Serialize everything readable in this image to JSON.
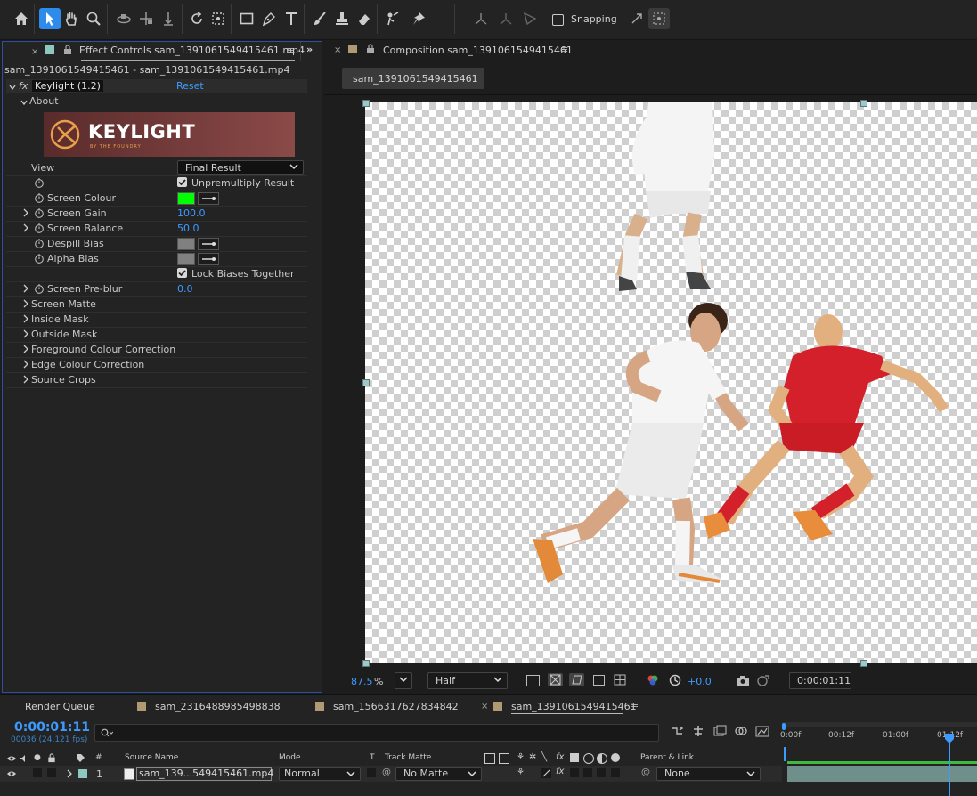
{
  "toolbar": {
    "snapping_label": "Snapping",
    "tools": [
      "home-icon",
      "selection-tool-icon",
      "hand-tool-icon",
      "zoom-tool-icon",
      "orbit-camera-icon",
      "pan-camera-icon",
      "dolly-camera-icon",
      "rotate-tool-icon",
      "anchor-point-tool-icon",
      "rectangle-tool-icon",
      "pen-tool-icon",
      "type-tool-icon",
      "brush-tool-icon",
      "clone-stamp-tool-icon",
      "eraser-tool-icon",
      "roto-brush-tool-icon",
      "puppet-pin-tool-icon"
    ]
  },
  "effect_controls": {
    "tab_label": "Effect Controls",
    "tab_file": "sam_1391061549415461.mp4",
    "layer_path": "sam_1391061549415461 - sam_1391061549415461.mp4",
    "effect_name": "Keylight (1.2)",
    "reset_label": "Reset",
    "about_label": "About",
    "logo_text": "KEYLIGHT",
    "logo_subtext": "BY THE FOUNDRY",
    "view_label": "View",
    "view_value": "Final Result",
    "unpremultiply_label": "Unpremultiply Result",
    "screen_colour_label": "Screen Colour",
    "screen_colour_hex": "#00ff00",
    "screen_gain_label": "Screen Gain",
    "screen_gain_value": "100.0",
    "screen_balance_label": "Screen Balance",
    "screen_balance_value": "50.0",
    "despill_bias_label": "Despill Bias",
    "despill_bias_hex": "#808080",
    "alpha_bias_label": "Alpha Bias",
    "alpha_bias_hex": "#808080",
    "lock_biases_label": "Lock Biases Together",
    "screen_preblur_label": "Screen Pre-blur",
    "screen_preblur_value": "0.0",
    "groups": [
      "Screen Matte",
      "Inside Mask",
      "Outside Mask",
      "Foreground Colour Correction",
      "Edge Colour Correction",
      "Source Crops"
    ]
  },
  "composition": {
    "tab_label": "Composition sam_1391061549415461",
    "sub_tab": "sam_1391061549415461",
    "zoom_value": "87.5",
    "zoom_unit": "%",
    "resolution": "Half",
    "exposure": "+0.0",
    "timecode": "0:00:01:11"
  },
  "timeline": {
    "render_queue": "Render Queue",
    "tabs": [
      "sam_2316488985498838",
      "sam_1566317627834842",
      "sam_1391061549415461"
    ],
    "current_time": "0:00:01:11",
    "frame_info": "00036 (24.121 fps)",
    "search_placeholder": "",
    "col_source": "Source Name",
    "col_mode": "Mode",
    "col_t": "T",
    "col_trackmatte": "Track Matte",
    "col_parent": "Parent & Link",
    "col_num": "#",
    "ruler": [
      "0:00f",
      "00:12f",
      "01:00f",
      "01:12f"
    ],
    "layer": {
      "number": "1",
      "name": "sam_139...549415461.mp4",
      "mode": "Normal",
      "matte": "No Matte",
      "parent": "None"
    }
  },
  "colors": {
    "accent": "#2d8ceb",
    "value_blue": "#3d9bff",
    "panel": "#232323"
  }
}
